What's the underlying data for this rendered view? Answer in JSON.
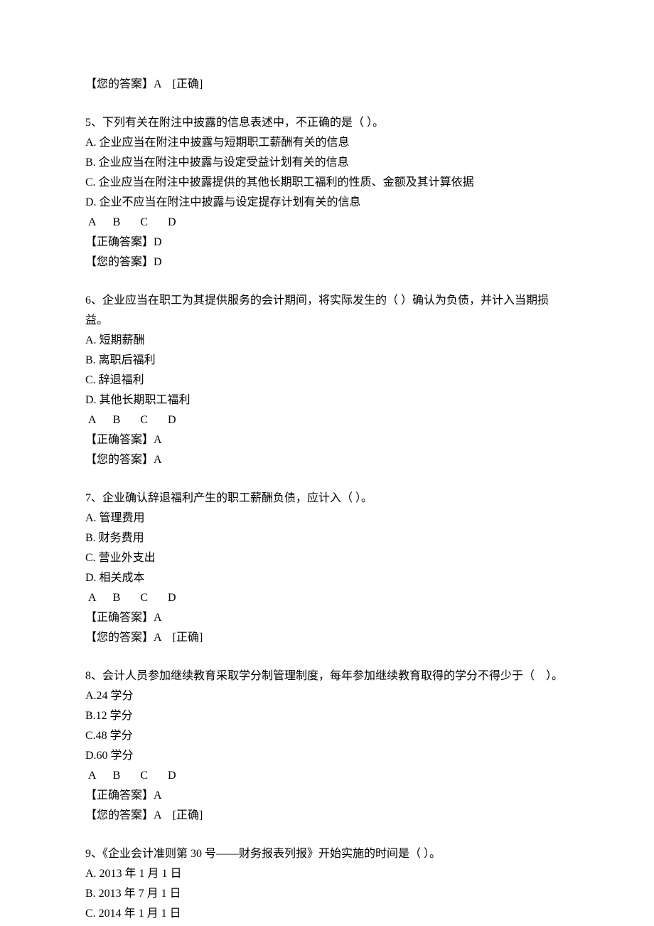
{
  "q4_tail": {
    "your_answer_label": "【您的答案】A    [正确]"
  },
  "q5": {
    "stem": "5、下列有关在附注中披露的信息表述中，不正确的是（ ）。",
    "optA": "A. 企业应当在附注中披露与短期职工薪酬有关的信息",
    "optB": "B. 企业应当在附注中披露与设定受益计划有关的信息",
    "optC": "C. 企业应当在附注中披露提供的其他长期职工福利的性质、金额及其计算依据",
    "optD": "D. 企业不应当在附注中披露与设定提存计划有关的信息",
    "choice_row": " A      B       C       D",
    "correct": "【正确答案】D",
    "your": "【您的答案】D"
  },
  "q6": {
    "stem": "6、企业应当在职工为其提供服务的会计期间，将实际发生的（ ）确认为负债，并计入当期损益。",
    "optA": "A. 短期薪酬",
    "optB": "B. 离职后福利",
    "optC": "C. 辞退福利",
    "optD": "D. 其他长期职工福利",
    "choice_row": " A      B       C       D",
    "correct": "【正确答案】A",
    "your": "【您的答案】A"
  },
  "q7": {
    "stem": "7、企业确认辞退福利产生的职工薪酬负债，应计入（ ）。",
    "optA": "A. 管理费用",
    "optB": "B. 财务费用",
    "optC": "C. 营业外支出",
    "optD": "D. 相关成本",
    "choice_row": " A      B       C       D",
    "correct": "【正确答案】A",
    "your": "【您的答案】A    [正确]"
  },
  "q8": {
    "stem": "8、会计人员参加继续教育采取学分制管理制度，每年参加继续教育取得的学分不得少于（    ）。",
    "optA": "A.24 学分",
    "optB": "B.12 学分",
    "optC": "C.48 学分",
    "optD": "D.60 学分",
    "choice_row": " A      B       C       D",
    "correct": "【正确答案】A",
    "your": "【您的答案】A    [正确]"
  },
  "q9": {
    "stem": "9、《企业会计准则第 30 号——财务报表列报》开始实施的时间是（ ）。",
    "optA": "A. 2013 年 1 月 1 日",
    "optB": "B. 2013 年 7 月 1 日",
    "optC": "C. 2014 年 1 月 1 日"
  }
}
